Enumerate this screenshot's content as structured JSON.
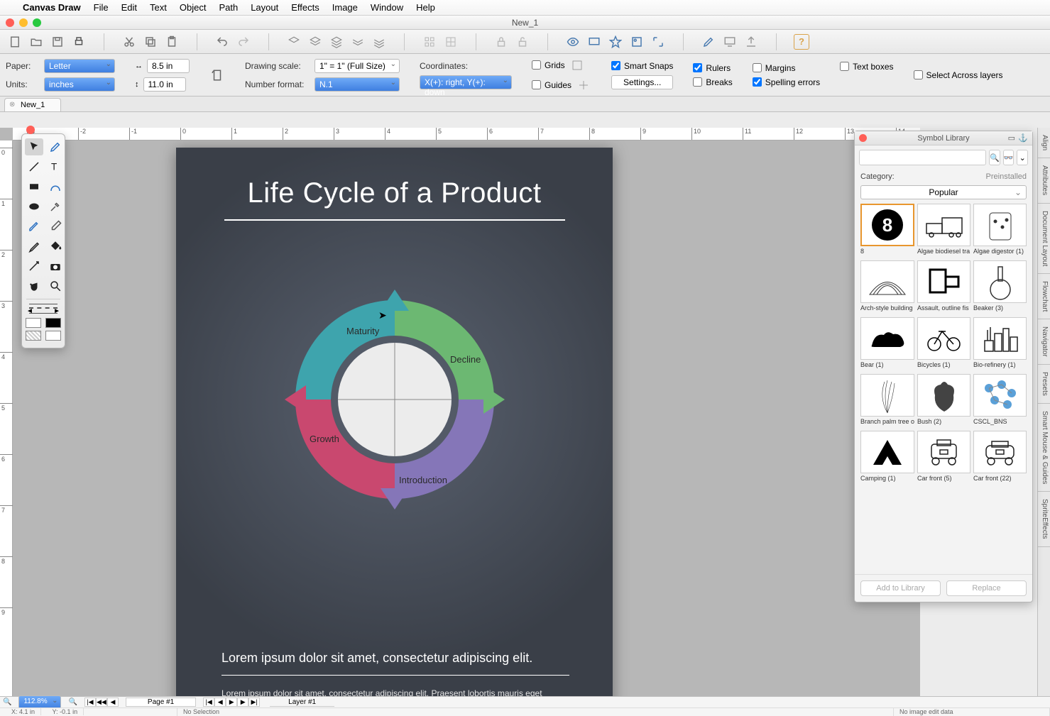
{
  "menubar": {
    "app": "Canvas Draw",
    "items": [
      "File",
      "Edit",
      "Text",
      "Object",
      "Path",
      "Layout",
      "Effects",
      "Image",
      "Window",
      "Help"
    ]
  },
  "window_title": "New_1",
  "options": {
    "paper_lbl": "Paper:",
    "paper_val": "Letter",
    "units_lbl": "Units:",
    "units_val": "inches",
    "width": "8.5 in",
    "height": "11.0 in",
    "scale_lbl": "Drawing scale:",
    "scale_val": "1\" = 1\"  (Full Size)",
    "numfmt_lbl": "Number format:",
    "numfmt_val": "N.1",
    "coords_lbl": "Coordinates:",
    "coords_val": "X(+): right, Y(+): down",
    "grids": "Grids",
    "smartsnaps": "Smart Snaps",
    "rulers": "Rulers",
    "margins": "Margins",
    "textboxes": "Text boxes",
    "guides": "Guides",
    "settings": "Settings...",
    "breaks": "Breaks",
    "spelling": "Spelling errors",
    "select_across": "Select Across layers"
  },
  "doctab": "New_1",
  "canvas": {
    "title": "Life Cycle of a Product",
    "seg1": "Maturity",
    "seg2": "Decline",
    "seg3": "Introduction",
    "seg4": "Growth",
    "lorem_h": "Lorem ipsum dolor sit amet, consectetur adipiscing elit.",
    "lorem_p": "Lorem ipsum dolor sit amet, consectetur adipiscing elit. Praesent lobortis mauris eget"
  },
  "symlib": {
    "title": "Symbol Library",
    "cat_lbl": "Category:",
    "preinst": "Preinstalled",
    "popular": "Popular",
    "items": [
      {
        "label": "8"
      },
      {
        "label": "Algae biodiesel tra"
      },
      {
        "label": "Algae digestor (1)"
      },
      {
        "label": "Arch-style building"
      },
      {
        "label": "Assault, outline fis"
      },
      {
        "label": "Beaker (3)"
      },
      {
        "label": "Bear (1)"
      },
      {
        "label": "Bicycles (1)"
      },
      {
        "label": "Bio-refinery (1)"
      },
      {
        "label": "Branch palm tree o"
      },
      {
        "label": "Bush (2)"
      },
      {
        "label": "CSCL_BNS"
      },
      {
        "label": "Camping (1)"
      },
      {
        "label": "Car front (5)"
      },
      {
        "label": "Car front (22)"
      }
    ],
    "add": "Add to Library",
    "replace": "Replace"
  },
  "vtabs": [
    "Align",
    "Attributes",
    "Document Layout",
    "Flowchart",
    "Navigator",
    "Presets",
    "Smart Mouse & Guides",
    "SpriteEffects"
  ],
  "status": {
    "zoom": "112.8%",
    "page": "Page #1",
    "layer": "Layer #1",
    "x": "X: 4.1 in",
    "y": "Y: -0.1 in",
    "sel": "No Selection",
    "img": "No image edit data"
  }
}
